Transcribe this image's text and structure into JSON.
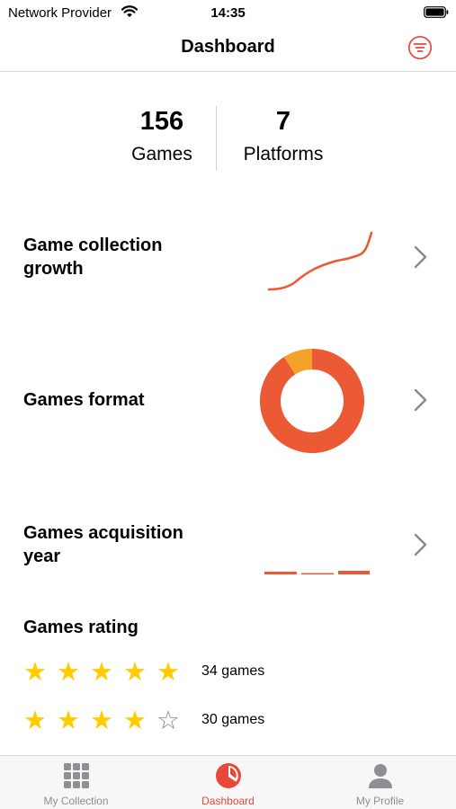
{
  "status_bar": {
    "carrier": "Network Provider",
    "time": "14:35"
  },
  "nav": {
    "title": "Dashboard",
    "filter_icon": "filter-icon"
  },
  "stats": {
    "games_value": "156",
    "games_label": "Games",
    "platforms_value": "7",
    "platforms_label": "Platforms"
  },
  "sections": {
    "growth": {
      "title": "Game collection growth",
      "icon": "line-sparkline"
    },
    "format": {
      "title": "Games format",
      "icon": "donut-chart",
      "shares": [
        {
          "part": "major",
          "fraction": 0.91,
          "color": "#ec5a35"
        },
        {
          "part": "minor",
          "fraction": 0.09,
          "color": "#f4a229"
        }
      ]
    },
    "year": {
      "title": "Games acquisition year",
      "icon": "bar-sparkline"
    }
  },
  "rating": {
    "title": "Games rating",
    "rows": [
      {
        "stars": 5,
        "of": 5,
        "count": "34 games"
      },
      {
        "stars": 4,
        "of": 5,
        "count": "30 games"
      }
    ]
  },
  "tabs": [
    {
      "label": "My Collection",
      "icon": "grid-icon",
      "selected": false
    },
    {
      "label": "Dashboard",
      "icon": "pie-chart-icon",
      "selected": true
    },
    {
      "label": "My Profile",
      "icon": "person-icon",
      "selected": false
    }
  ],
  "colors": {
    "accent": "#e8473a",
    "orange": "#ec5a35",
    "light_orange": "#f4a229",
    "star": "#ffcc00",
    "tab_inactive": "#8e8e93"
  }
}
